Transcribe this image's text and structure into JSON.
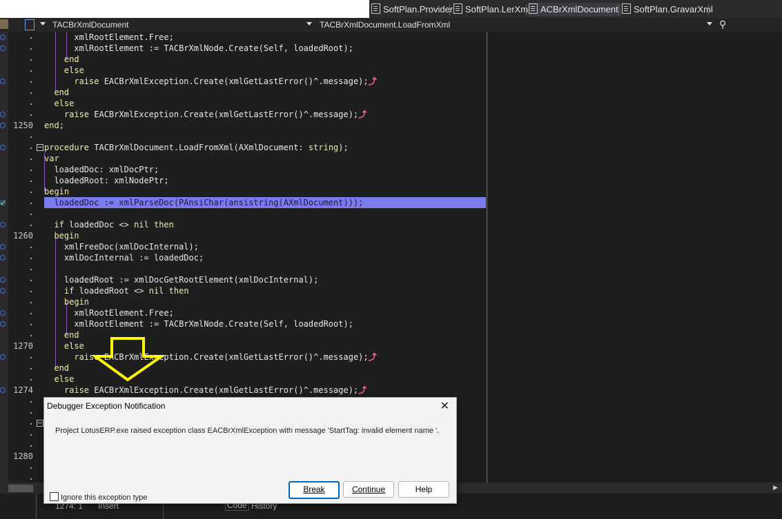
{
  "tabs": [
    {
      "label": "SoftPlan.Provider",
      "active": false
    },
    {
      "label": "SoftPlan.LerXml",
      "active": false
    },
    {
      "label": "ACBrXmlDocument",
      "active": true
    },
    {
      "label": "SoftPlan.GravarXml",
      "active": false
    }
  ],
  "navbar": {
    "class_combo": "TACBrXmlDocument",
    "method_combo": "TACBrXmlDocument.LoadFromXml"
  },
  "line_numbers": [
    {
      "text": "1250",
      "row": 8
    },
    {
      "text": "1260",
      "row": 18
    },
    {
      "text": "1270",
      "row": 28
    },
    {
      "text": "1274",
      "row": 32
    },
    {
      "text": "1280",
      "row": 38
    }
  ],
  "code_lines": [
    "      xmlRootElement.Free;",
    "      xmlRootElement := TACBrXmlNode.Create(Self, loadedRoot);",
    "    end",
    "    else",
    "      raise EACBrXmlException.Create(xmlGetLastError()^.message);",
    "  end",
    "  else",
    "    raise EACBrXmlException.Create(xmlGetLastError()^.message);",
    "end;",
    "",
    "procedure TACBrXmlDocument.LoadFromXml(AXmlDocument: string);",
    "var",
    "  loadedDoc: xmlDocPtr;",
    "  loadedRoot: xmlNodePtr;",
    "begin",
    "  loadedDoc := xmlParseDoc(PAnsiChar(ansistring(AXmlDocument)));",
    "",
    "  if loadedDoc <> nil then",
    "  begin",
    "    xmlFreeDoc(xmlDocInternal);",
    "    xmlDocInternal := loadedDoc;",
    "",
    "    loadedRoot := xmlDocGetRootElement(xmlDocInternal);",
    "    if loadedRoot <> nil then",
    "    begin",
    "      xmlRootElement.Free;",
    "      xmlRootElement := TACBrXmlNode.Create(Self, loadedRoot);",
    "    end",
    "    else",
    "      raise EACBrXmlException.Create(xmlGetLastError()^.message);",
    "  end",
    "  else",
    "    raise EACBrXmlException.Create(xmlGetLastError()^.message);"
  ],
  "dialog": {
    "title": "Debugger Exception Notification",
    "close_glyph": "✕",
    "message": "Project LotusERP.exe raised exception class EACBrXmlException with message 'StartTag: invalid element name '.",
    "break_label": "Break",
    "continue_label": "Continue",
    "help_label": "Help",
    "checkbox_label": "Ignore this exception type"
  },
  "status": {
    "position": "1274:  1",
    "mode": "Insert",
    "tab_code": "Code",
    "tab_history": "History"
  },
  "icons": {
    "raise_marker": "⤴",
    "search": "search-icon"
  }
}
